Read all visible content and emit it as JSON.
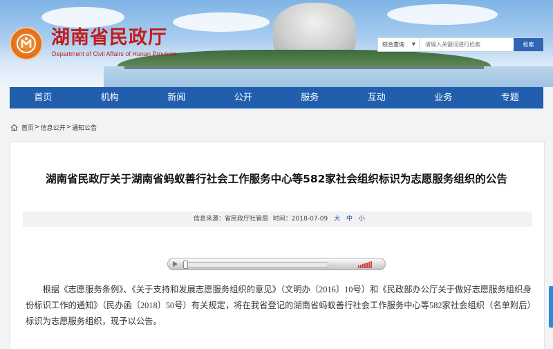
{
  "header": {
    "site_title": "湖南省民政厅",
    "site_subtitle": "Department of Civil Affairs of Hunan Province",
    "logo_icon": "ministry-emblem-icon"
  },
  "search": {
    "scope_selected": "综合查询",
    "placeholder": "请输入关键词进行检索",
    "button_label": "检索"
  },
  "nav": {
    "items": [
      {
        "label": "首页"
      },
      {
        "label": "机构"
      },
      {
        "label": "新闻"
      },
      {
        "label": "公开"
      },
      {
        "label": "服务"
      },
      {
        "label": "互动"
      },
      {
        "label": "业务"
      },
      {
        "label": "专题"
      }
    ]
  },
  "breadcrumb": {
    "home_icon": "home-icon",
    "items": [
      "首页",
      "信息公开",
      "通知公告"
    ],
    "separator": ">"
  },
  "article": {
    "title": "湖南省民政厅关于湖南省蚂蚁善行社会工作服务中心等582家社会组织标识为志愿服务组织的公告",
    "source_label": "信息来源：",
    "source_value": "省民政厅社管局",
    "time_label": "时间：",
    "time_value": "2018-07-09",
    "size_large": "大",
    "size_medium": "中",
    "size_small": "小",
    "body": "根据《志愿服务条例》、《关于支持和发展志愿服务组织的意见》（文明办〔2016〕10号）和《民政部办公厅关于做好志愿服务组织身份标识工作的通知》（民办函〔2018〕50号）有关规定，将在我省登记的湖南省蚂蚁善行社会工作服务中心等582家社会组织（名单附后）标识为志愿服务组织，现予以公告。"
  },
  "colors": {
    "nav_bg": "#215fae",
    "title_red": "#c21b1b",
    "search_button": "#2e66b4"
  }
}
